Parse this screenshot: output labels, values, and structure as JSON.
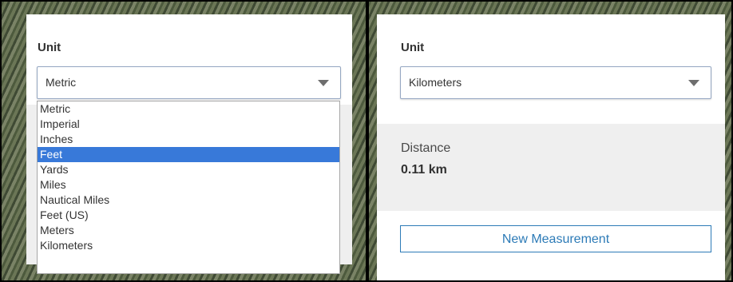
{
  "left_panel": {
    "unit_label": "Unit",
    "select_value": "Metric",
    "dropdown_options": [
      "Metric",
      "Imperial",
      "Inches",
      "Feet",
      "Yards",
      "Miles",
      "Nautical Miles",
      "Feet (US)",
      "Meters",
      "Kilometers"
    ],
    "highlighted_option": "Feet"
  },
  "right_panel": {
    "unit_label": "Unit",
    "select_value": "Kilometers",
    "distance_label": "Distance",
    "distance_value": "0.11 km",
    "new_measurement_label": "New Measurement"
  },
  "colors": {
    "accent": "#2d7bb7",
    "highlight": "#3879d9"
  }
}
